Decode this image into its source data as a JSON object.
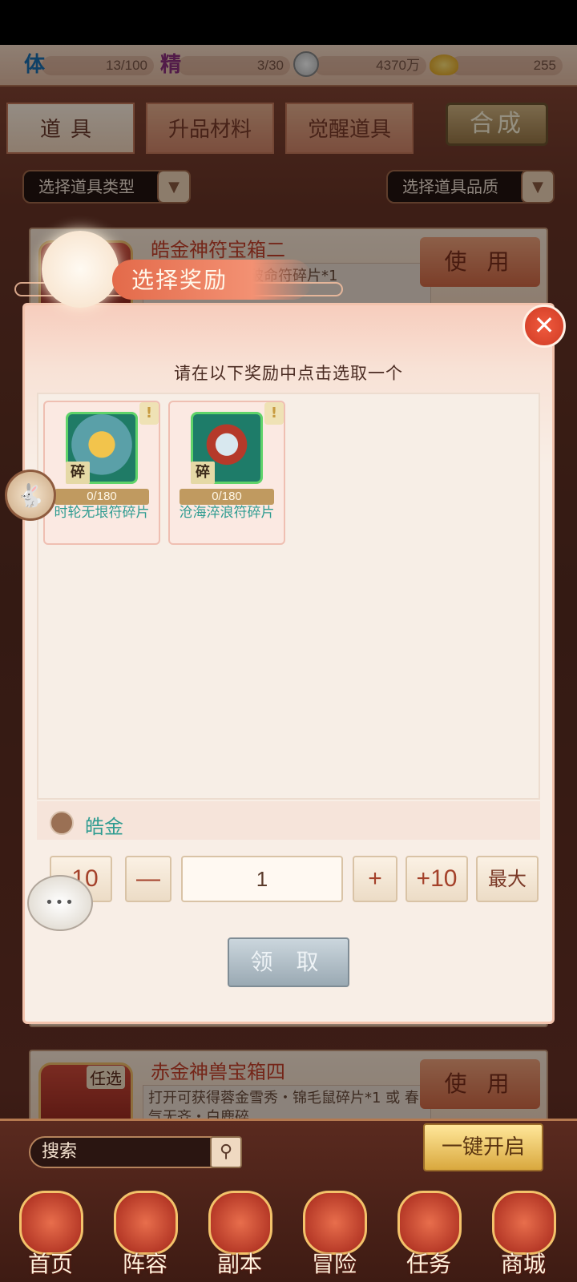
{
  "resources": {
    "stamina": {
      "icon": "stamina-icon",
      "symbol": "体",
      "value": "13/100"
    },
    "spirit": {
      "icon": "spirit-icon",
      "symbol": "精",
      "value": "3/30"
    },
    "silver": {
      "icon": "silver-coin-icon",
      "value": "4370万"
    },
    "gold": {
      "icon": "gold-ingot-icon",
      "value": "255"
    }
  },
  "tabs": [
    {
      "label": "道具",
      "active": true
    },
    {
      "label": "升品材料",
      "active": false
    },
    {
      "label": "觉醒道具",
      "active": false
    }
  ],
  "synthesize_label": "合成",
  "filters": {
    "type_placeholder": "选择道具类型",
    "quality_placeholder": "选择道具品质",
    "arrow_icon": "chevron-down-icon"
  },
  "list_items": [
    {
      "name": "皓金神符宝箱二",
      "desc": "打开可获得金刚破命符碎片*1",
      "use_label": "使 用"
    },
    {
      "name": "赤金神兽宝箱四",
      "badge": "任选",
      "desc": "打开可获得蓉金雪秀・锦毛鼠碎片*1 或 春气无齐・白鹿碎",
      "use_label": "使 用"
    }
  ],
  "modal": {
    "title": "选择奖励",
    "prompt": "请在以下奖励中点击选取一个",
    "close_icon": "close-icon",
    "rewards": [
      {
        "name": "时轮无垠符碎片",
        "progress": "0/180",
        "tag": "碎",
        "mark": "!"
      },
      {
        "name": "沧海淬浪符碎片",
        "progress": "0/180",
        "tag": "碎",
        "mark": "!"
      }
    ],
    "quality_label": "皓金",
    "quantity": {
      "minus10": "-10",
      "minus": "—",
      "value": "1",
      "plus": "+",
      "plus10": "+10",
      "max": "最大"
    },
    "claim_label": "领 取"
  },
  "bottom": {
    "search_placeholder": "搜索",
    "search_icon": "search-icon",
    "one_key_label": "一键开启",
    "nav": [
      "首页",
      "阵容",
      "副本",
      "冒险",
      "任务",
      "商城"
    ]
  },
  "colors": {
    "accent_red": "#d46a46",
    "jade_text": "#2f9c91",
    "modal_bg": "#f8eee6"
  }
}
